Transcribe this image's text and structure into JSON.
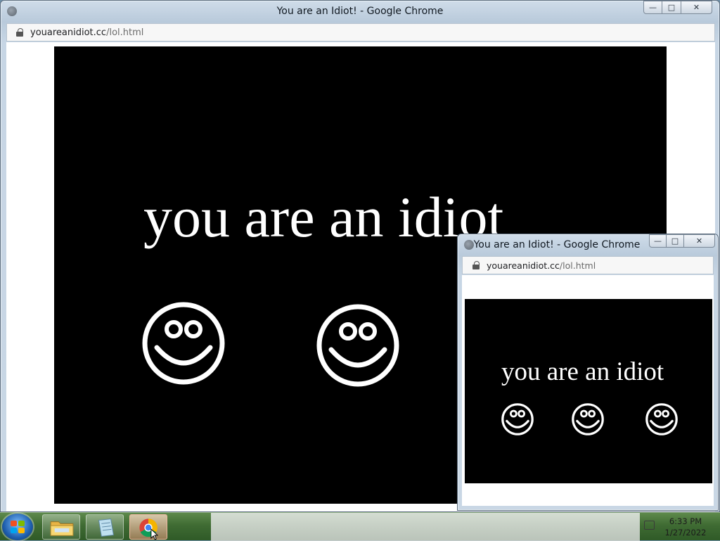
{
  "main_window": {
    "title": "You are an Idiot! - Google Chrome",
    "url_host": "youareanidiot.cc",
    "url_path": "/lol.html",
    "headline": "you are an idiot",
    "controls": {
      "minimize": "—",
      "maximize": "□",
      "close": "✕"
    }
  },
  "popup_window": {
    "title": "You are an Idiot! - Google Chrome",
    "url_host": "youareanidiot.cc",
    "url_path": "/lol.html",
    "headline": "you are an idiot",
    "controls": {
      "minimize": "—",
      "maximize": "□",
      "close": "✕"
    }
  },
  "taskbar": {
    "buttons": [
      {
        "name": "windows-explorer",
        "icon": "folder-icon"
      },
      {
        "name": "notepad",
        "icon": "notepad-icon"
      },
      {
        "name": "google-chrome",
        "icon": "chrome-icon",
        "active": true
      }
    ],
    "clock_time": "6:33 PM",
    "clock_date": "1/27/2022"
  },
  "colors": {
    "page_background": "#000000",
    "page_text": "#ffffff",
    "taskbar": "#3f6b33"
  }
}
